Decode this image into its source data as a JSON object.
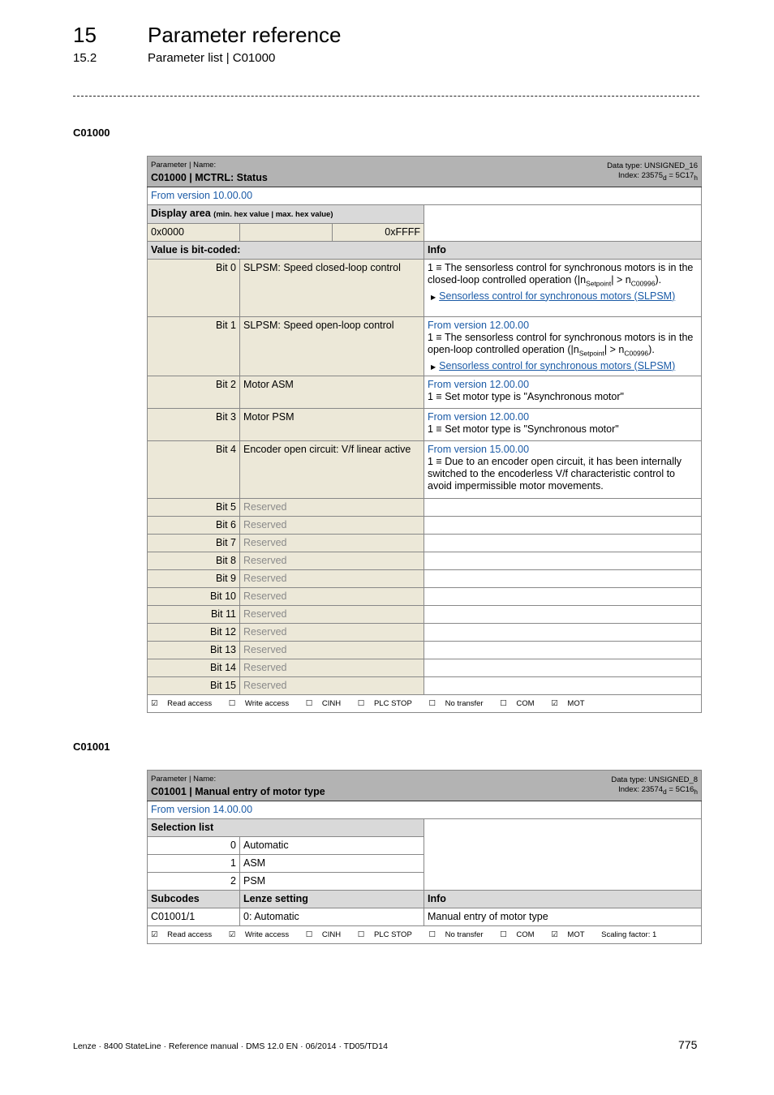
{
  "header": {
    "chapter_number": "15",
    "chapter_title": "Parameter reference",
    "section_number": "15.2",
    "section_title": "Parameter list | C01000"
  },
  "c01000": {
    "heading": "C01000",
    "param_label": "Parameter | Name:",
    "param_name": "C01000 | MCTRL: Status",
    "data_type": "Data type: UNSIGNED_16",
    "index_prefix": "Index: 23575",
    "index_dec_sub": "d",
    "index_mid": " = 5C17",
    "index_hex_sub": "h",
    "version": "From version 10.00.00",
    "display_area_label": "Display area",
    "display_area_hint": "(min. hex value | max. hex value)",
    "min_value": "0x0000",
    "max_value": "0xFFFF",
    "bitcoded_label": "Value is bit-coded:",
    "info_label": "Info",
    "bits": [
      {
        "bit": "Bit 0",
        "name": "SLPSM: Speed closed-loop control",
        "version": "",
        "info_pre": "1 ≡ The sensorless control for synchronous motors is in the closed-loop controlled operation (|n",
        "sub1": "Setpoint",
        "info_mid": "| > n",
        "sub2": "C00996",
        "info_post": ").",
        "link": "Sensorless control for synchronous motors (SLPSM)"
      },
      {
        "bit": "Bit 1",
        "name": "SLPSM: Speed open-loop control",
        "version": "From version 12.00.00",
        "info_pre": "1 ≡ The sensorless control for synchronous motors is in the open-loop controlled operation (|n",
        "sub1": "Setpoint",
        "info_mid": "| > n",
        "sub2": "C00996",
        "info_post": ").",
        "link": "Sensorless control for synchronous motors (SLPSM)"
      },
      {
        "bit": "Bit 2",
        "name": "Motor ASM",
        "version": "From version 12.00.00",
        "info": "1 ≡ Set motor type is \"Asynchronous motor\""
      },
      {
        "bit": "Bit 3",
        "name": "Motor PSM",
        "version": "From version 12.00.00",
        "info": "1 ≡ Set motor type is \"Synchronous motor\""
      },
      {
        "bit": "Bit 4",
        "name": "Encoder open circuit: V/f linear active",
        "version": "From version 15.00.00",
        "info": "1 ≡ Due to an encoder open circuit, it has been internally switched to the encoderless V/f characteristic control to avoid impermissible motor movements."
      },
      {
        "bit": "Bit 5",
        "name": "Reserved"
      },
      {
        "bit": "Bit 6",
        "name": "Reserved"
      },
      {
        "bit": "Bit 7",
        "name": "Reserved"
      },
      {
        "bit": "Bit 8",
        "name": "Reserved"
      },
      {
        "bit": "Bit 9",
        "name": "Reserved"
      },
      {
        "bit": "Bit 10",
        "name": "Reserved"
      },
      {
        "bit": "Bit 11",
        "name": "Reserved"
      },
      {
        "bit": "Bit 12",
        "name": "Reserved"
      },
      {
        "bit": "Bit 13",
        "name": "Reserved"
      },
      {
        "bit": "Bit 14",
        "name": "Reserved"
      },
      {
        "bit": "Bit 15",
        "name": "Reserved"
      }
    ],
    "access": [
      {
        "label": "Read access",
        "checked": true
      },
      {
        "label": "Write access",
        "checked": false
      },
      {
        "label": "CINH",
        "checked": false
      },
      {
        "label": "PLC STOP",
        "checked": false
      },
      {
        "label": "No transfer",
        "checked": false
      },
      {
        "label": "COM",
        "checked": false
      },
      {
        "label": "MOT",
        "checked": true
      }
    ]
  },
  "c01001": {
    "heading": "C01001",
    "param_label": "Parameter | Name:",
    "param_name": "C01001 | Manual entry of motor type",
    "data_type": "Data type: UNSIGNED_8",
    "index_prefix": "Index: 23574",
    "index_dec_sub": "d",
    "index_mid": " = 5C16",
    "index_hex_sub": "h",
    "version": "From version 14.00.00",
    "selection_label": "Selection list",
    "selections": [
      {
        "value": "0",
        "label": "Automatic"
      },
      {
        "value": "1",
        "label": "ASM"
      },
      {
        "value": "2",
        "label": "PSM"
      }
    ],
    "subcodes_label": "Subcodes",
    "lenze_label": "Lenze setting",
    "info_label": "Info",
    "subcode": {
      "code": "C01001/1",
      "setting": "0: Automatic",
      "info": "Manual entry of motor type"
    },
    "access": [
      {
        "label": "Read access",
        "checked": true
      },
      {
        "label": "Write access",
        "checked": true
      },
      {
        "label": "CINH",
        "checked": false
      },
      {
        "label": "PLC STOP",
        "checked": false
      },
      {
        "label": "No transfer",
        "checked": false
      },
      {
        "label": "COM",
        "checked": false
      },
      {
        "label": "MOT",
        "checked": true
      }
    ],
    "scaling": "Scaling factor: 1"
  },
  "footer": {
    "text": "Lenze · 8400 StateLine · Reference manual · DMS 12.0 EN · 06/2014 · TD05/TD14",
    "page_number": "775"
  }
}
